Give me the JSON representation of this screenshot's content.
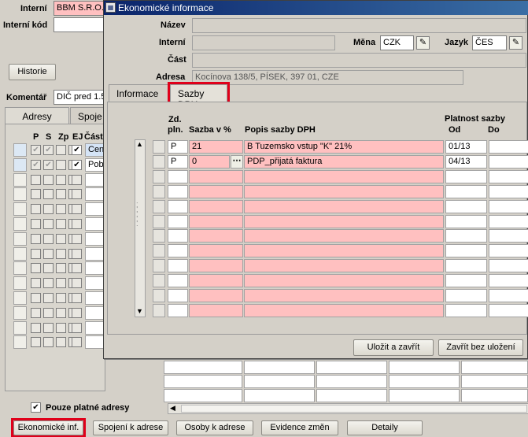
{
  "background": {
    "interni_label": "Interní",
    "interni_value": "BBM S.R.O.",
    "interni_kod_label": "Interní kód",
    "historie_button": "Historie",
    "komentar_label": "Komentář",
    "komentar_value": "DIČ pred 1.5",
    "tabs": [
      "Adresy",
      "Spoje"
    ],
    "columns": [
      "P",
      "S",
      "Zp",
      "EJ",
      "Část"
    ],
    "rows": [
      {
        "text": "Cen"
      },
      {
        "text": "Pob"
      }
    ],
    "pouze_label": "Pouze platné adresy",
    "bottom_buttons": [
      "Ekonomické inf.",
      "Spojení k adrese",
      "Osoby k adrese",
      "Evidence změn",
      "Detaily"
    ]
  },
  "dialog": {
    "title": "Ekonomické informace",
    "nazev_label": "Název",
    "interni_label": "Interní",
    "mena_label": "Měna",
    "mena_value": "CZK",
    "jazyk_label": "Jazyk",
    "jazyk_value": "ČES",
    "cast_label": "Část",
    "adresa_label": "Adresa",
    "adresa_value": "Kocínova 138/5, PÍSEK, 397 01, CZE",
    "tabs": [
      "Informace",
      "Sazby DPH"
    ],
    "grid": {
      "h_zd": "Zd.",
      "h_pln": "pln.",
      "h_sazba": "Sazba v %",
      "h_popis": "Popis sazby DPH",
      "h_platnost": "Platnost sazby",
      "h_od": "Od",
      "h_do": "Do",
      "rows": [
        {
          "zd": "P",
          "sazba": "21",
          "popis": "B  Tuzemsko vstup \"K\" 21%",
          "od": "01/13",
          "do": ""
        },
        {
          "zd": "P",
          "sazba": "0",
          "popis": "PDP_přijatá faktura",
          "od": "04/13",
          "do": ""
        }
      ]
    },
    "ulozit_button": "Uložit a zavřít",
    "zavrit_button": "Zavřít bez uložení"
  },
  "colors": {
    "pink": "#ffc0c0",
    "title_bar": "#0a246a",
    "red_highlight": "#e0001a"
  }
}
